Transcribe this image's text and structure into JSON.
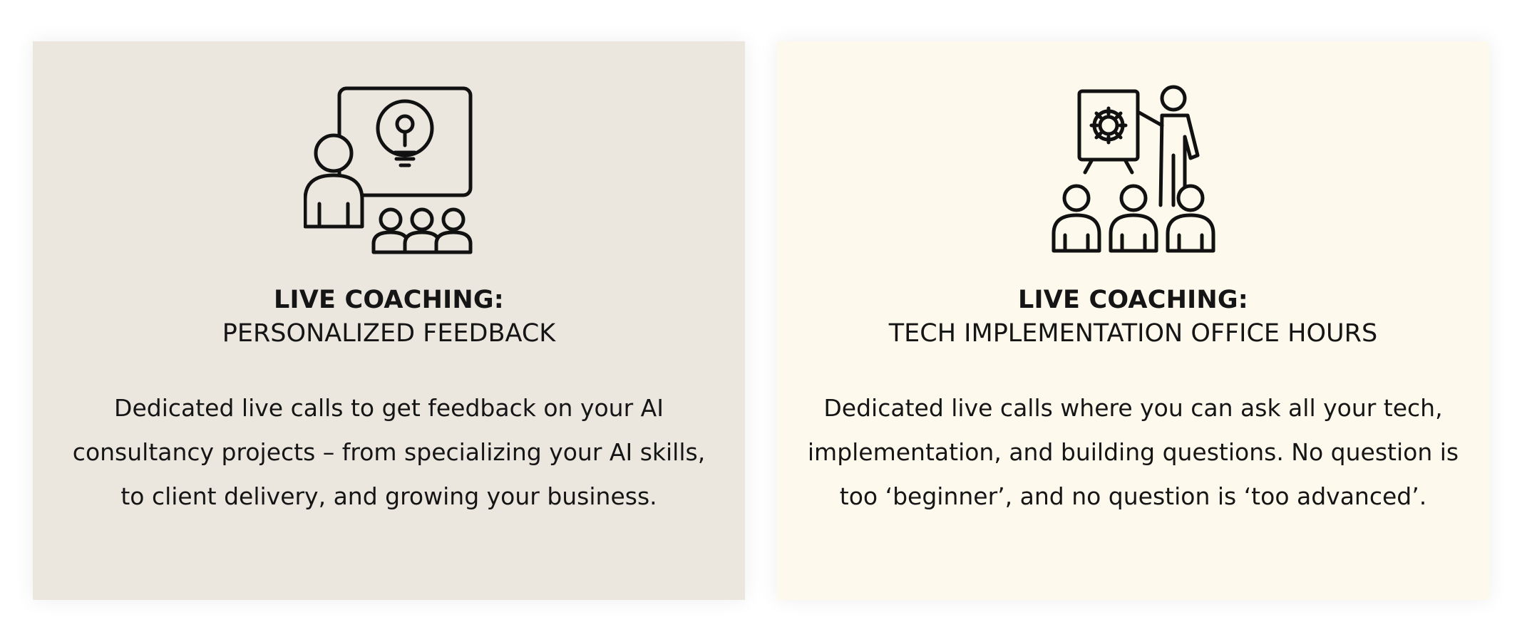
{
  "colors": {
    "card_left_bg": "#ebe7df",
    "card_right_bg": "#fdf9ec",
    "text": "#151515",
    "icon_stroke": "#111111"
  },
  "cards": [
    {
      "icon": "presentation-idea-audience-icon",
      "title": "LIVE COACHING:",
      "subtitle": "PERSONALIZED FEEDBACK",
      "description": "Dedicated live calls to get feedback on your AI consultancy projects – from specializing your AI skills, to client delivery, and growing your business."
    },
    {
      "icon": "trainer-gear-board-audience-icon",
      "title": "LIVE COACHING:",
      "subtitle": "TECH IMPLEMENTATION OFFICE HOURS",
      "description": "Dedicated live calls where you can ask all your tech, implementation, and building questions. No question is too ‘beginner’, and no question is ‘too advanced’."
    }
  ]
}
